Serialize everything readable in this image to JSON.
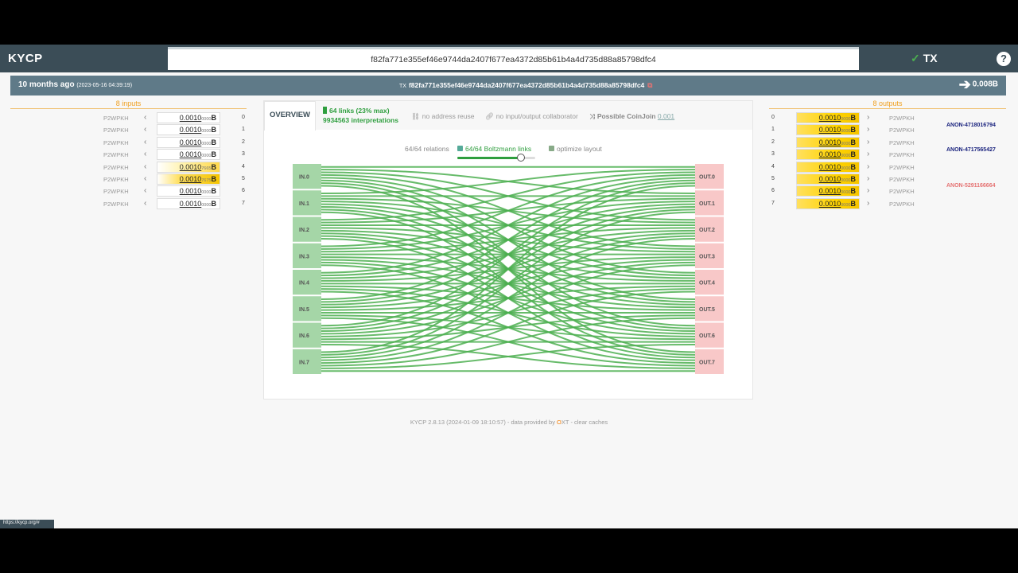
{
  "app": {
    "name": "KYCP"
  },
  "search": {
    "value": "f82fa771e355ef46e9744da2407f677ea4372d85b61b4a4d735d88a85798dfc4"
  },
  "header": {
    "tx_label": "TX",
    "help": "?"
  },
  "txbar": {
    "ago": "10 months ago",
    "date": "(2023-05-16 04:39:19)",
    "tx_prefix": "TX",
    "txid": "f82fa771e355ef46e9744da2407f677ea4372d85b61b4a4d735d88a85798dfc4",
    "total": "0.008B"
  },
  "inputs": {
    "title": "8 inputs",
    "items": [
      {
        "type": "P2WPKH",
        "amount_main": "0.0010",
        "amount_small": "0000",
        "unit": "B",
        "index": "0",
        "highlight": "none"
      },
      {
        "type": "P2WPKH",
        "amount_main": "0.0010",
        "amount_small": "0000",
        "unit": "B",
        "index": "1",
        "highlight": "none"
      },
      {
        "type": "P2WPKH",
        "amount_main": "0.0010",
        "amount_small": "0000",
        "unit": "B",
        "index": "2",
        "highlight": "none"
      },
      {
        "type": "P2WPKH",
        "amount_main": "0.0010",
        "amount_small": "0000",
        "unit": "B",
        "index": "3",
        "highlight": "none"
      },
      {
        "type": "P2WPKH",
        "amount_main": "0.0010",
        "amount_small": "7665",
        "unit": "B",
        "index": "4",
        "highlight": "light"
      },
      {
        "type": "P2WPKH",
        "amount_main": "0.0010",
        "amount_small": "7675",
        "unit": "B",
        "index": "5",
        "highlight": "mid"
      },
      {
        "type": "P2WPKH",
        "amount_main": "0.0010",
        "amount_small": "0000",
        "unit": "B",
        "index": "6",
        "highlight": "none"
      },
      {
        "type": "P2WPKH",
        "amount_main": "0.0010",
        "amount_small": "0000",
        "unit": "B",
        "index": "7",
        "highlight": "none"
      }
    ]
  },
  "outputs": {
    "title": "8 outputs",
    "items": [
      {
        "index": "0",
        "amount_main": "0.0010",
        "amount_small": "0000",
        "unit": "B",
        "type": "P2WPKH",
        "anon": ""
      },
      {
        "index": "1",
        "amount_main": "0.0010",
        "amount_small": "0000",
        "unit": "B",
        "type": "P2WPKH",
        "anon": "ANON-4718016794"
      },
      {
        "index": "2",
        "amount_main": "0.0010",
        "amount_small": "0000",
        "unit": "B",
        "type": "P2WPKH",
        "anon": ""
      },
      {
        "index": "3",
        "amount_main": "0.0010",
        "amount_small": "0000",
        "unit": "B",
        "type": "P2WPKH",
        "anon": "ANON-4717565427"
      },
      {
        "index": "4",
        "amount_main": "0.0010",
        "amount_small": "0000",
        "unit": "B",
        "type": "P2WPKH",
        "anon": ""
      },
      {
        "index": "5",
        "amount_main": "0.0010",
        "amount_small": "0000",
        "unit": "B",
        "type": "P2WPKH",
        "anon": ""
      },
      {
        "index": "6",
        "amount_main": "0.0010",
        "amount_small": "0000",
        "unit": "B",
        "type": "P2WPKH",
        "anon": "ANON-5291166664"
      },
      {
        "index": "7",
        "amount_main": "0.0010",
        "amount_small": "0000",
        "unit": "B",
        "type": "P2WPKH",
        "anon": ""
      }
    ],
    "anon_colors": [
      "#1a237e",
      "#1a237e",
      "#e57373"
    ]
  },
  "overview": {
    "tab": "OVERVIEW",
    "links": "64 links (23% max)",
    "interpretations": "9934563 interpretations",
    "heuristics": {
      "address_reuse": "no address reuse",
      "collaborator": "no input/output collaborator",
      "coinjoin": "Possible CoinJoin",
      "coinjoin_score": "0.001"
    },
    "relations": "64/64 relations",
    "boltzmann": "64/64 Boltzmann links",
    "optimize": "optimize layout",
    "slider_fraction": 0.82
  },
  "diagram": {
    "inputs": [
      "IN.0",
      "IN.1",
      "IN.2",
      "IN.3",
      "IN.4",
      "IN.5",
      "IN.6",
      "IN.7"
    ],
    "outputs": [
      "OUT.0",
      "OUT.1",
      "OUT.2",
      "OUT.3",
      "OUT.4",
      "OUT.5",
      "OUT.6",
      "OUT.7"
    ],
    "link_color": "#4caf50",
    "in_color": "#a5d6a7",
    "out_color": "#f8c8c8"
  },
  "footer": {
    "version": "KYCP 2.8.13 (2024-01-09 18:10:57) - data provided by",
    "provider_o": "O",
    "provider_rest": "XT",
    "clear": "- clear caches"
  },
  "status_url": "https://kycp.org/#"
}
